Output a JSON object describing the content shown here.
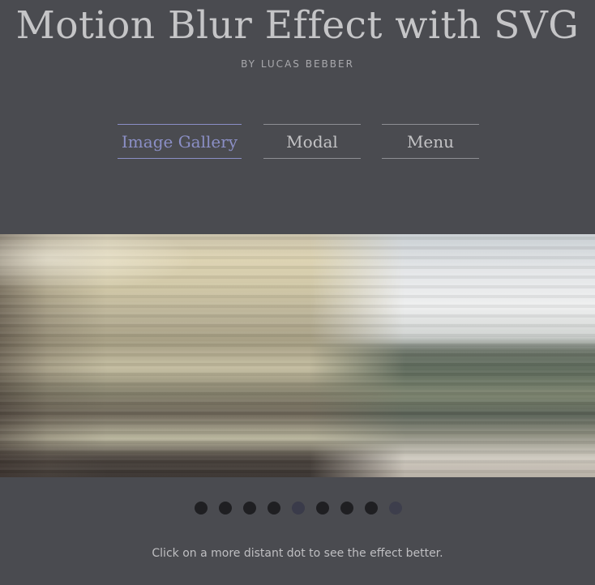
{
  "header": {
    "title": "Motion Blur Effect with SVG",
    "byline": "BY LUCAS BEBBER"
  },
  "nav": {
    "tabs": [
      {
        "label": "Image Gallery",
        "active": true
      },
      {
        "label": "Modal",
        "active": false
      },
      {
        "label": "Menu",
        "active": false
      }
    ]
  },
  "gallery": {
    "dot_count": 9,
    "active_index": 4
  },
  "hint": "Click on a more distant dot to see the effect better.",
  "colors": {
    "background": "#4a4b50",
    "accent": "#8b8fc6",
    "dot": "#1f1f22"
  }
}
